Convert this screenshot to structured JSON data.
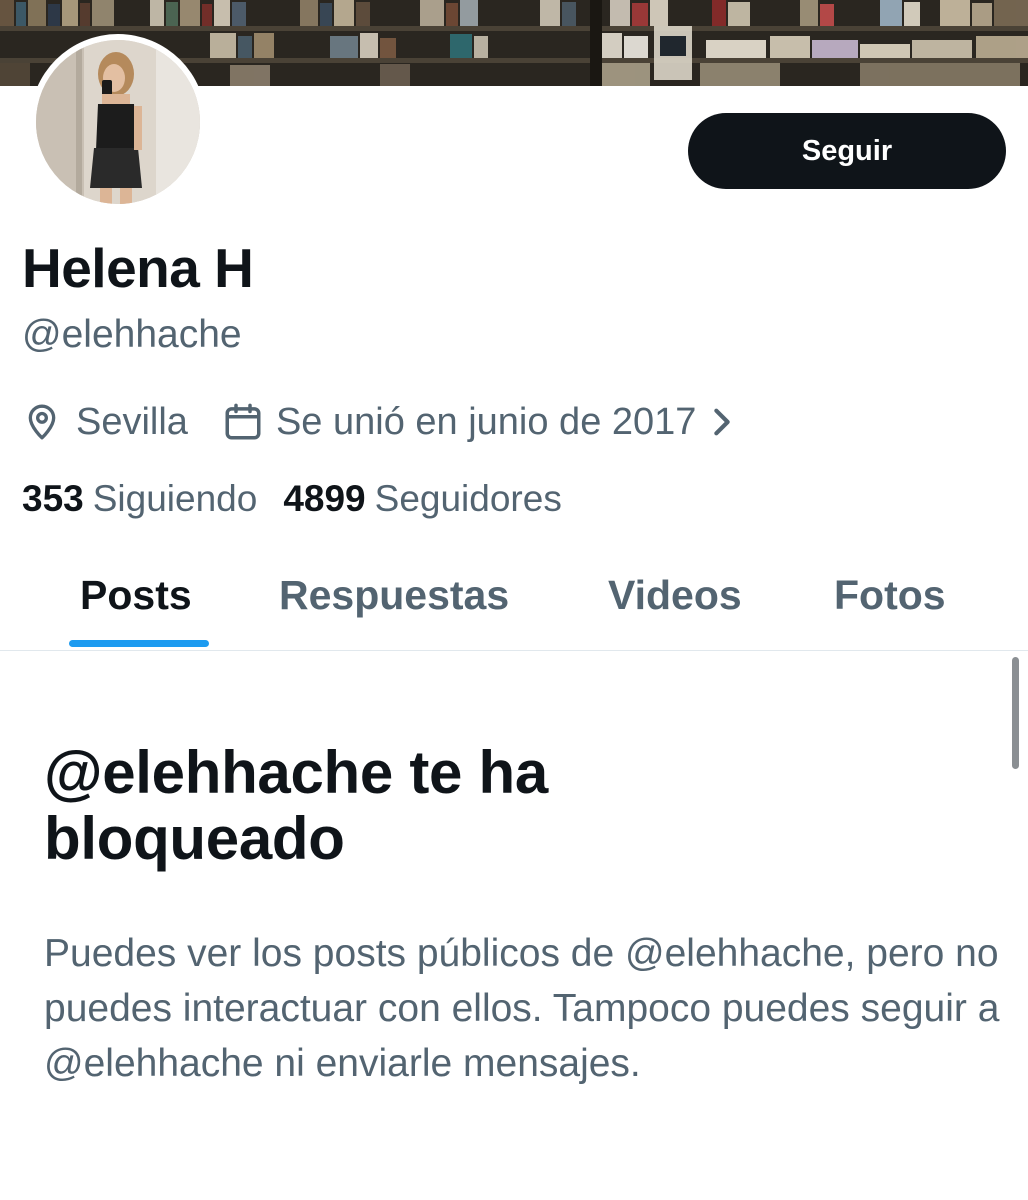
{
  "profile": {
    "display_name": "Helena H",
    "handle": "@elehhache",
    "location": "Sevilla",
    "joined": "Se unió en junio de 2017",
    "following_count": "353",
    "following_label": "Siguiendo",
    "followers_count": "4899",
    "followers_label": "Seguidores"
  },
  "actions": {
    "follow_label": "Seguir"
  },
  "tabs": [
    {
      "label": "Posts",
      "active": true
    },
    {
      "label": "Respuestas",
      "active": false
    },
    {
      "label": "Videos",
      "active": false
    },
    {
      "label": "Fotos",
      "active": false
    }
  ],
  "blocked": {
    "title": "@elehhache te ha bloqueado",
    "body": "Puedes ver los posts públicos de @elehhache, pero no puedes interactuar con ellos. Tampoco puedes seguir a @elehhache ni enviarle mensajes."
  },
  "icons": {
    "location": "location-pin-icon",
    "calendar": "calendar-icon",
    "chevron": "chevron-right-icon"
  },
  "colors": {
    "text_primary": "#0f1419",
    "text_secondary": "#536471",
    "accent": "#1d9bf0",
    "button_bg": "#0f1419",
    "button_text": "#ffffff"
  }
}
